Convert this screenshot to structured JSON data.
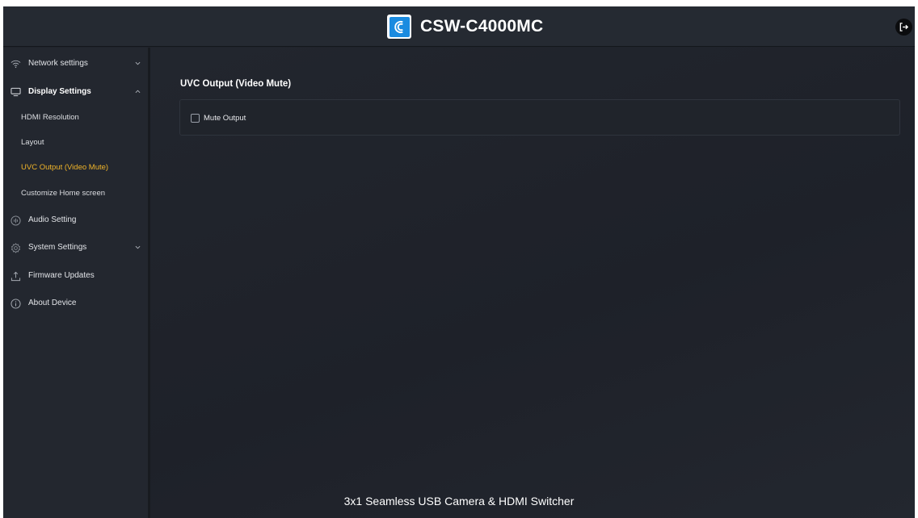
{
  "header": {
    "title": "CSW-C4000MC",
    "logo_icon": "crestron-c-logo-icon",
    "logout_icon": "logout-icon"
  },
  "sidebar": {
    "items": [
      {
        "label": "Network settings",
        "icon": "wifi-icon",
        "expanded": false,
        "has_chevron": true
      },
      {
        "label": "Display Settings",
        "icon": "monitor-icon",
        "expanded": true,
        "has_chevron": true
      },
      {
        "label": "Audio Setting",
        "icon": "audio-icon"
      },
      {
        "label": "System Settings",
        "icon": "gear-icon",
        "expanded": false,
        "has_chevron": true
      },
      {
        "label": "Firmware Updates",
        "icon": "upload-icon"
      },
      {
        "label": "About Device",
        "icon": "info-icon"
      }
    ],
    "display_sub_items": [
      {
        "label": "HDMI Resolution",
        "active": false
      },
      {
        "label": "Layout",
        "active": false
      },
      {
        "label": "UVC Output (Video Mute)",
        "active": true
      },
      {
        "label": "Customize Home screen",
        "active": false
      }
    ]
  },
  "main": {
    "section_title": "UVC Output (Video Mute)",
    "mute_output": {
      "label": "Mute Output",
      "checked": false
    }
  },
  "footer": {
    "text": "3x1 Seamless USB Camera & HDMI Switcher"
  },
  "colors": {
    "accent_active": "#f0b429",
    "logo_blue": "#1a8be0",
    "background": "#1f232b"
  }
}
